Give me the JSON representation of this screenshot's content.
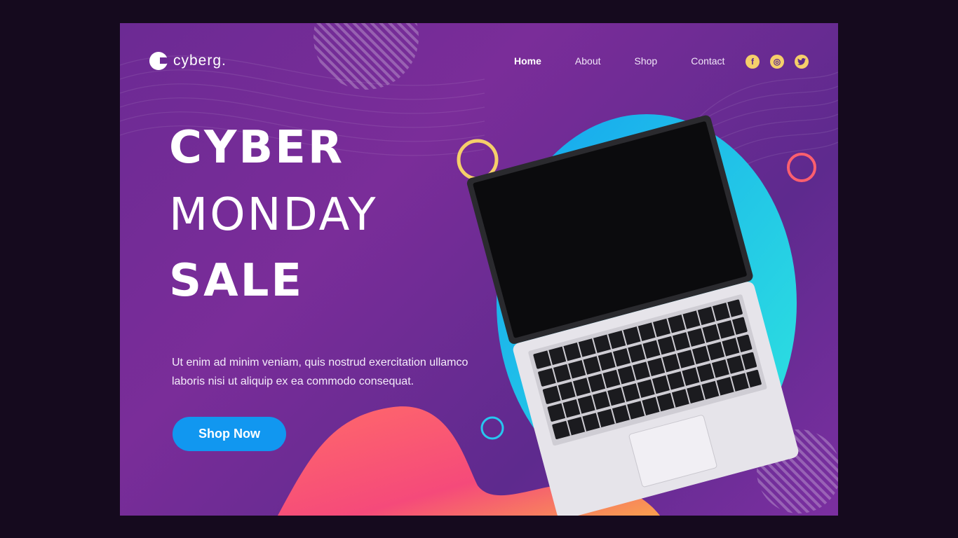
{
  "brand": {
    "name": "cyberg.",
    "icon": "logo-mark-icon"
  },
  "nav": {
    "items": [
      "Home",
      "About",
      "Shop",
      "Contact"
    ],
    "active": "Home"
  },
  "social": [
    {
      "name": "facebook-icon",
      "glyph": "f"
    },
    {
      "name": "instagram-icon",
      "glyph": "◎"
    },
    {
      "name": "twitter-icon",
      "glyph": "🐦"
    }
  ],
  "hero": {
    "line1": "CYBER",
    "line2": "MONDAY",
    "line3": "SALE",
    "description": "Ut enim ad minim veniam, quis nostrud exercitation ullamco laboris nisi ut aliquip ex ea commodo consequat.",
    "cta": "Shop Now"
  },
  "colors": {
    "background": "#150a1e",
    "panel": "#6c2a94",
    "accent_button": "#1197f0",
    "icon_fill": "#f5cf6a",
    "blob_cyan": "#27d4e8",
    "blob_coral": "#fd5f6e"
  }
}
